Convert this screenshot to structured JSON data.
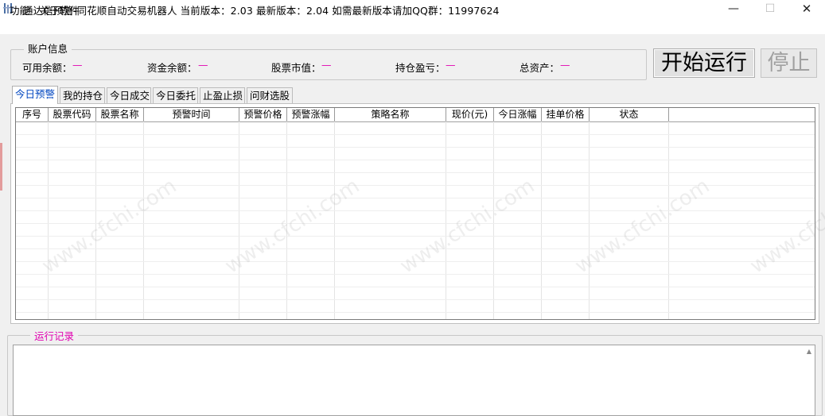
{
  "window": {
    "title": "通达信预警-同花顺自动交易机器人    当前版本：2.03     最新版本：2.04     如需最新版本请加QQ群：11997624",
    "minimize_glyph": "—",
    "maximize_glyph": "☐",
    "close_glyph": "✕"
  },
  "menu": {
    "items": [
      {
        "label": "功能"
      },
      {
        "label": "关于软件"
      }
    ]
  },
  "account": {
    "title": "账户信息",
    "fields": [
      {
        "label": "可用余额：",
        "value": "—"
      },
      {
        "label": "资金余额：",
        "value": "—"
      },
      {
        "label": "股票市值：",
        "value": "—"
      },
      {
        "label": "持仓盈亏：",
        "value": "—"
      },
      {
        "label": "总资产：",
        "value": "—"
      }
    ]
  },
  "buttons": {
    "start": "开始运行",
    "stop": "停止"
  },
  "tabs": [
    {
      "label": "今日预警",
      "active": true
    },
    {
      "label": "我的持仓"
    },
    {
      "label": "今日成交"
    },
    {
      "label": "今日委托"
    },
    {
      "label": "止盈止损"
    },
    {
      "label": "问财选股"
    }
  ],
  "table": {
    "columns": [
      "序号",
      "股票代码",
      "股票名称",
      "预警时间",
      "预警价格",
      "预警涨幅",
      "策略名称",
      "现价(元)",
      "今日涨幅",
      "挂单价格",
      "状态"
    ],
    "rows": []
  },
  "log": {
    "title": "运行记录"
  },
  "watermark": "www.cfchi.com",
  "colors": {
    "accent_magenta": "#e000b0",
    "active_tab_text": "#0046c0"
  }
}
